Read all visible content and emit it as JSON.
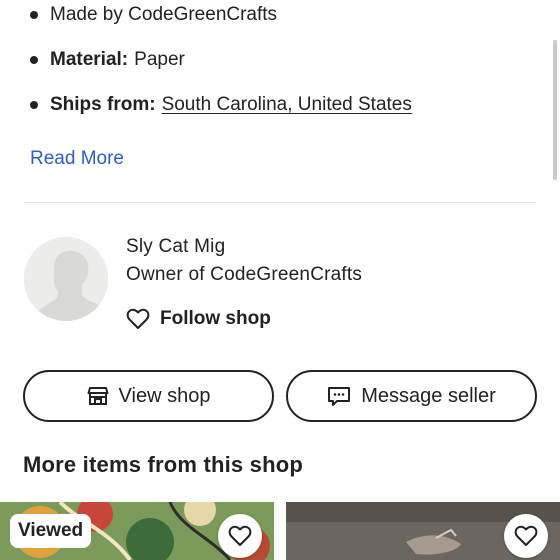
{
  "details": {
    "made_by": "Made by CodeGreenCrafts",
    "material_label": "Material:",
    "material_value": "Paper",
    "ships_label": "Ships from:",
    "ships_value": "South Carolina, United States"
  },
  "read_more": "Read More",
  "seller": {
    "name": "Sly Cat Mig",
    "role": "Owner of CodeGreenCrafts",
    "follow_label": "Follow shop"
  },
  "buttons": {
    "view_shop": "View shop",
    "message_seller": "Message seller"
  },
  "more_items": {
    "title": "More items from this shop",
    "items": [
      {
        "badge": "Viewed",
        "favorite_icon": "heart-outline-icon"
      },
      {
        "badge": "",
        "favorite_icon": "heart-outline-icon"
      }
    ]
  },
  "colors": {
    "link": "#2f5fc0",
    "text": "#222222",
    "divider": "#e6e6e6"
  }
}
